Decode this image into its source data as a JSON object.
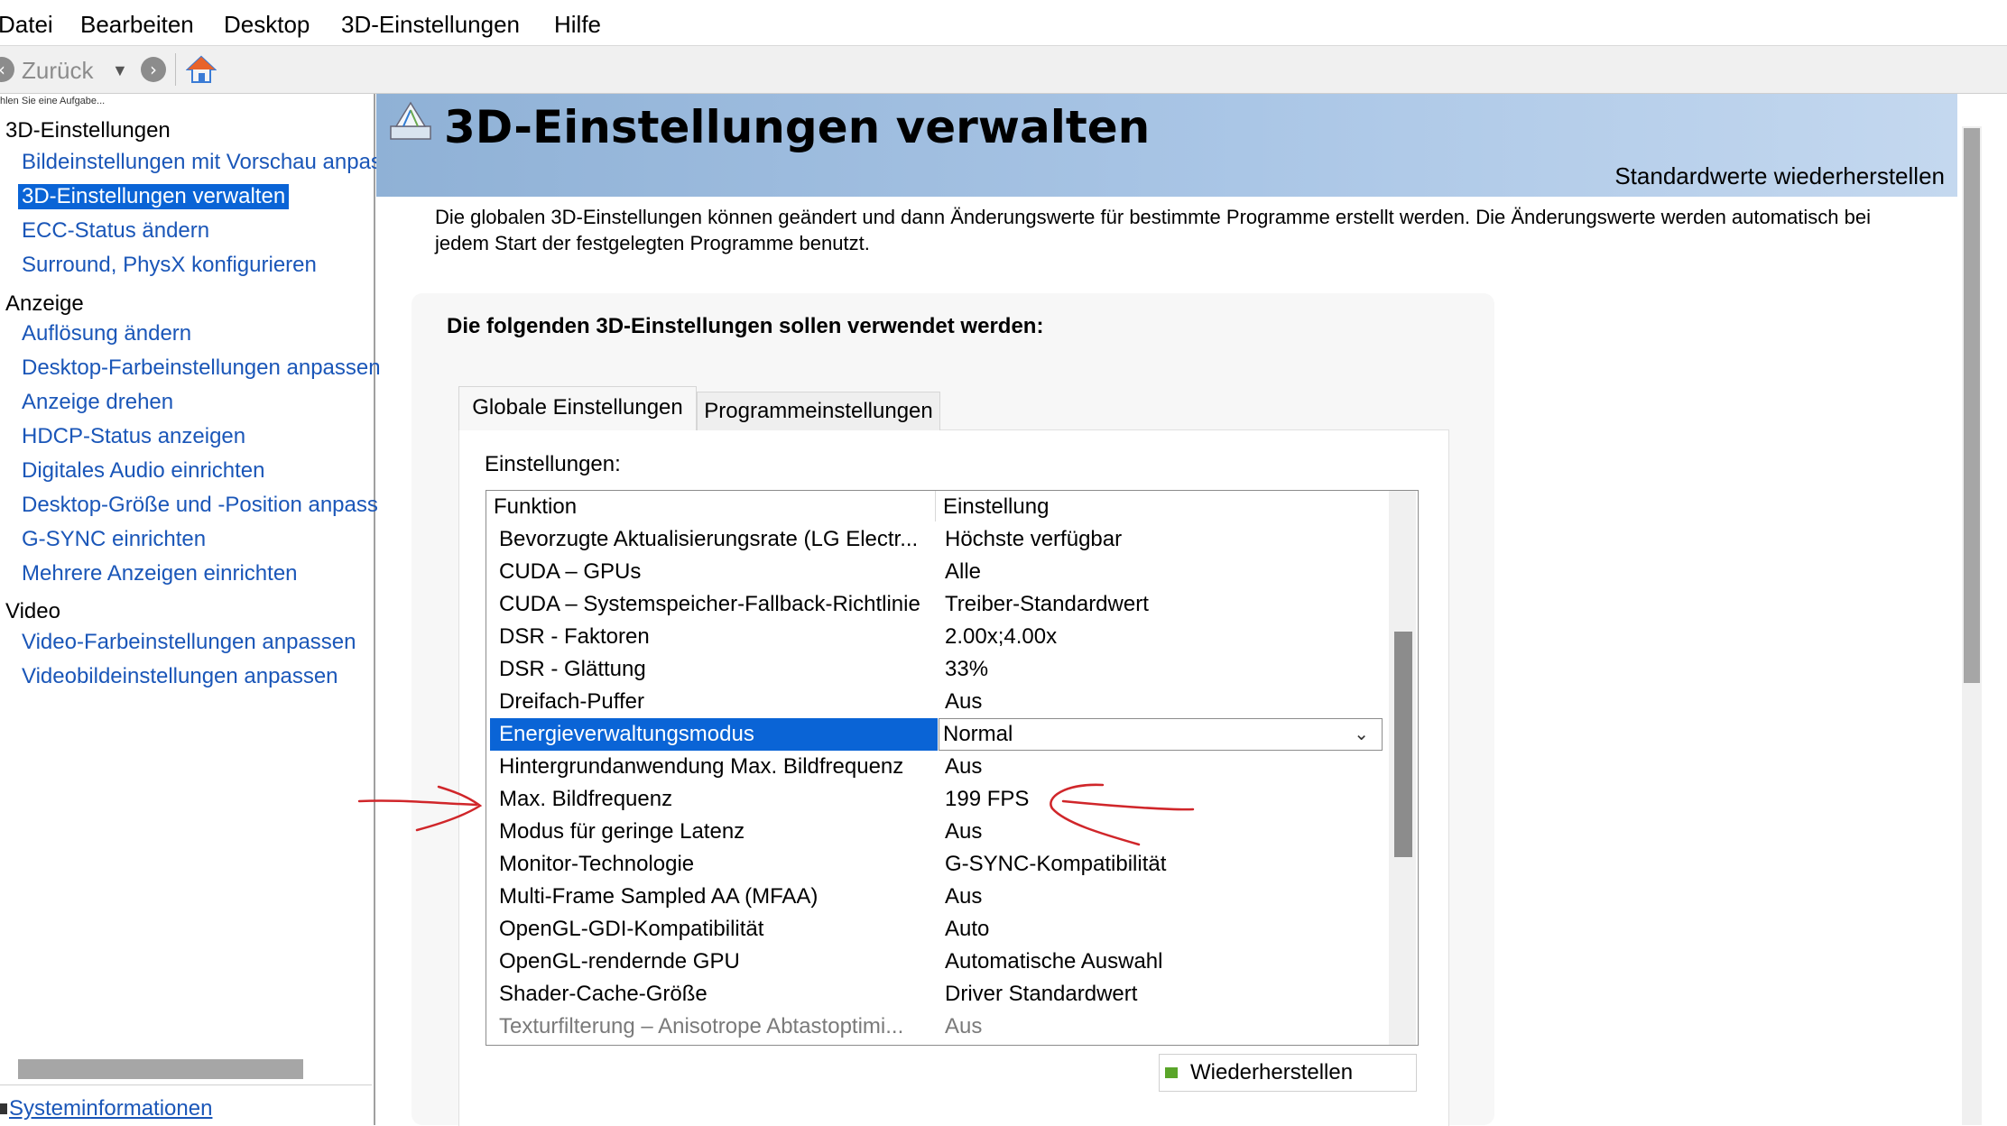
{
  "menu": [
    "Datei",
    "Bearbeiten",
    "Desktop",
    "3D-Einstellungen",
    "Hilfe"
  ],
  "toolbar": {
    "back_label": "Zurück"
  },
  "sidebar": {
    "hint": "hlen Sie eine Aufgabe...",
    "categories": [
      {
        "label": "3D-Einstellungen",
        "items": [
          "Bildeinstellungen mit Vorschau anpas",
          "3D-Einstellungen verwalten",
          "ECC-Status ändern",
          "Surround, PhysX konfigurieren"
        ]
      },
      {
        "label": "Anzeige",
        "items": [
          "Auflösung ändern",
          "Desktop-Farbeinstellungen anpassen",
          "Anzeige drehen",
          "HDCP-Status anzeigen",
          "Digitales Audio einrichten",
          "Desktop-Größe und -Position anpass",
          "G-SYNC einrichten",
          "Mehrere Anzeigen einrichten"
        ]
      },
      {
        "label": "Video",
        "items": [
          "Video-Farbeinstellungen anpassen",
          "Videobildeinstellungen anpassen"
        ]
      }
    ],
    "selected": "3D-Einstellungen verwalten",
    "system_info": "Systeminformationen"
  },
  "page": {
    "title": "3D-Einstellungen verwalten",
    "restore_defaults": "Standardwerte wiederherstellen",
    "description": "Die globalen 3D-Einstellungen können geändert und dann Änderungswerte für bestimmte Programme erstellt werden. Die Änderungswerte werden automatisch bei jedem Start der festgelegten Programme benutzt.",
    "panel_title": "Die folgenden 3D-Einstellungen sollen verwendet werden:",
    "tabs": [
      "Globale Einstellungen",
      "Programmeinstellungen"
    ],
    "settings_label": "Einstellungen:",
    "columns": [
      "Funktion",
      "Einstellung"
    ],
    "rows": [
      {
        "f": "Bevorzugte Aktualisierungsrate (LG Electr...",
        "v": "Höchste verfügbar"
      },
      {
        "f": "CUDA – GPUs",
        "v": "Alle"
      },
      {
        "f": "CUDA – Systemspeicher-Fallback-Richtlinie",
        "v": "Treiber-Standardwert"
      },
      {
        "f": "DSR - Faktoren",
        "v": "2.00x;4.00x"
      },
      {
        "f": "DSR - Glättung",
        "v": "33%"
      },
      {
        "f": "Dreifach-Puffer",
        "v": "Aus"
      },
      {
        "f": "Energieverwaltungsmodus",
        "v": "Normal"
      },
      {
        "f": "Hintergrundanwendung Max. Bildfrequenz",
        "v": "Aus"
      },
      {
        "f": "Max. Bildfrequenz",
        "v": "199 FPS"
      },
      {
        "f": "Modus für geringe Latenz",
        "v": "Aus"
      },
      {
        "f": "Monitor-Technologie",
        "v": "G-SYNC-Kompatibilität"
      },
      {
        "f": "Multi-Frame Sampled AA (MFAA)",
        "v": "Aus"
      },
      {
        "f": "OpenGL-GDI-Kompatibilität",
        "v": "Auto"
      },
      {
        "f": "OpenGL-rendernde GPU",
        "v": "Automatische Auswahl"
      },
      {
        "f": "Shader-Cache-Größe",
        "v": "Driver Standardwert"
      },
      {
        "f": "Texturfilterung – Anisotrope Abtastoptimi...",
        "v": "Aus"
      }
    ],
    "restore_button": "Wiederherstellen"
  },
  "colors": {
    "selection": "#0a64d6",
    "link": "#1a56b8",
    "annotation": "#d0262a"
  }
}
